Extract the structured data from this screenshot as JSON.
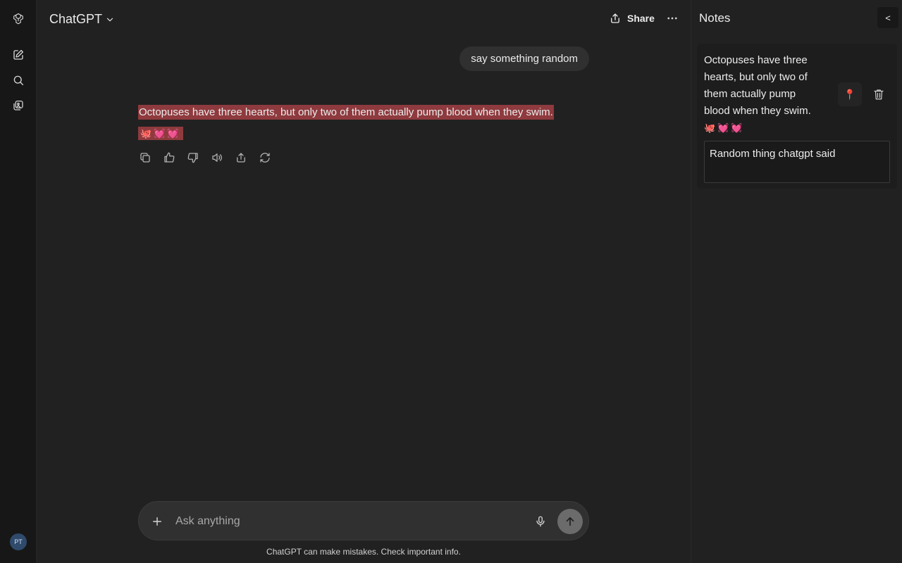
{
  "header": {
    "model_name": "ChatGPT",
    "share_label": "Share",
    "more_label": "···"
  },
  "sidebar": {
    "items": [
      {
        "name": "logo",
        "icon": "openai-logo-icon"
      },
      {
        "name": "new-chat",
        "icon": "edit-icon"
      },
      {
        "name": "search",
        "icon": "search-icon"
      },
      {
        "name": "library",
        "icon": "library-icon"
      }
    ],
    "avatar_initials": "PT"
  },
  "chat": {
    "user_message": "say something random",
    "assistant_message": "Octopuses have three hearts, but only two of them actually pump blood when they swim.",
    "assistant_emojis": "🐙💓💓",
    "actions": [
      "copy-icon",
      "thumbs-up-icon",
      "thumbs-down-icon",
      "read-aloud-icon",
      "share-icon",
      "regenerate-icon"
    ],
    "highlight_color": "#8e3a3e"
  },
  "composer": {
    "placeholder": "Ask anything",
    "disclaimer": "ChatGPT can make mistakes. Check important info."
  },
  "notes": {
    "title": "Notes",
    "collapse_label": "<",
    "note_text": "Octopuses have three hearts, but only two of them actually pump blood when they swim.",
    "note_emojis": "🐙💓💓",
    "note_label_value": "Random thing chatgpt said",
    "pin_icon": "📍"
  }
}
